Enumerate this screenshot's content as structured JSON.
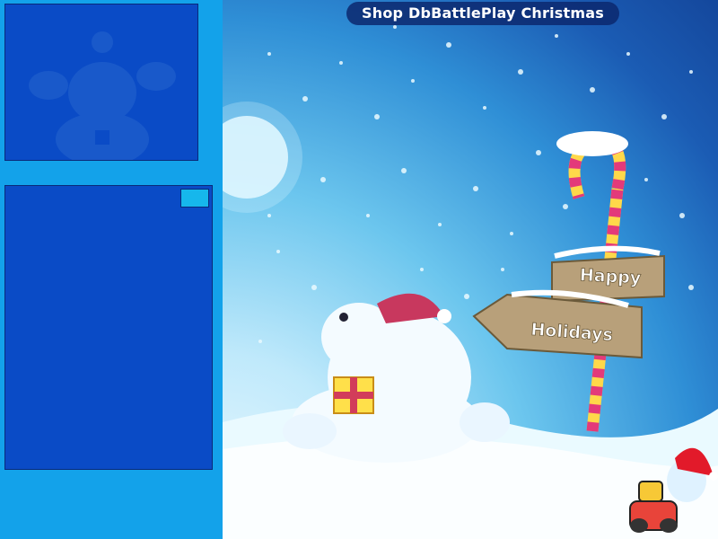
{
  "header": {
    "title": "Shop DbBattlePlay Christmas"
  },
  "sign": {
    "top": "Happy",
    "bottom": "Holidays"
  },
  "icons": {
    "santa": "santa-silhouette-icon",
    "shop_toggle": "expand-toggle-icon",
    "mascot": "santa-hat-mascot-icon"
  },
  "colors": {
    "rail": "#13a2ea",
    "panel": "#0a4bc6",
    "toggle": "#16b7ec",
    "title_bg": "#0c286e"
  }
}
